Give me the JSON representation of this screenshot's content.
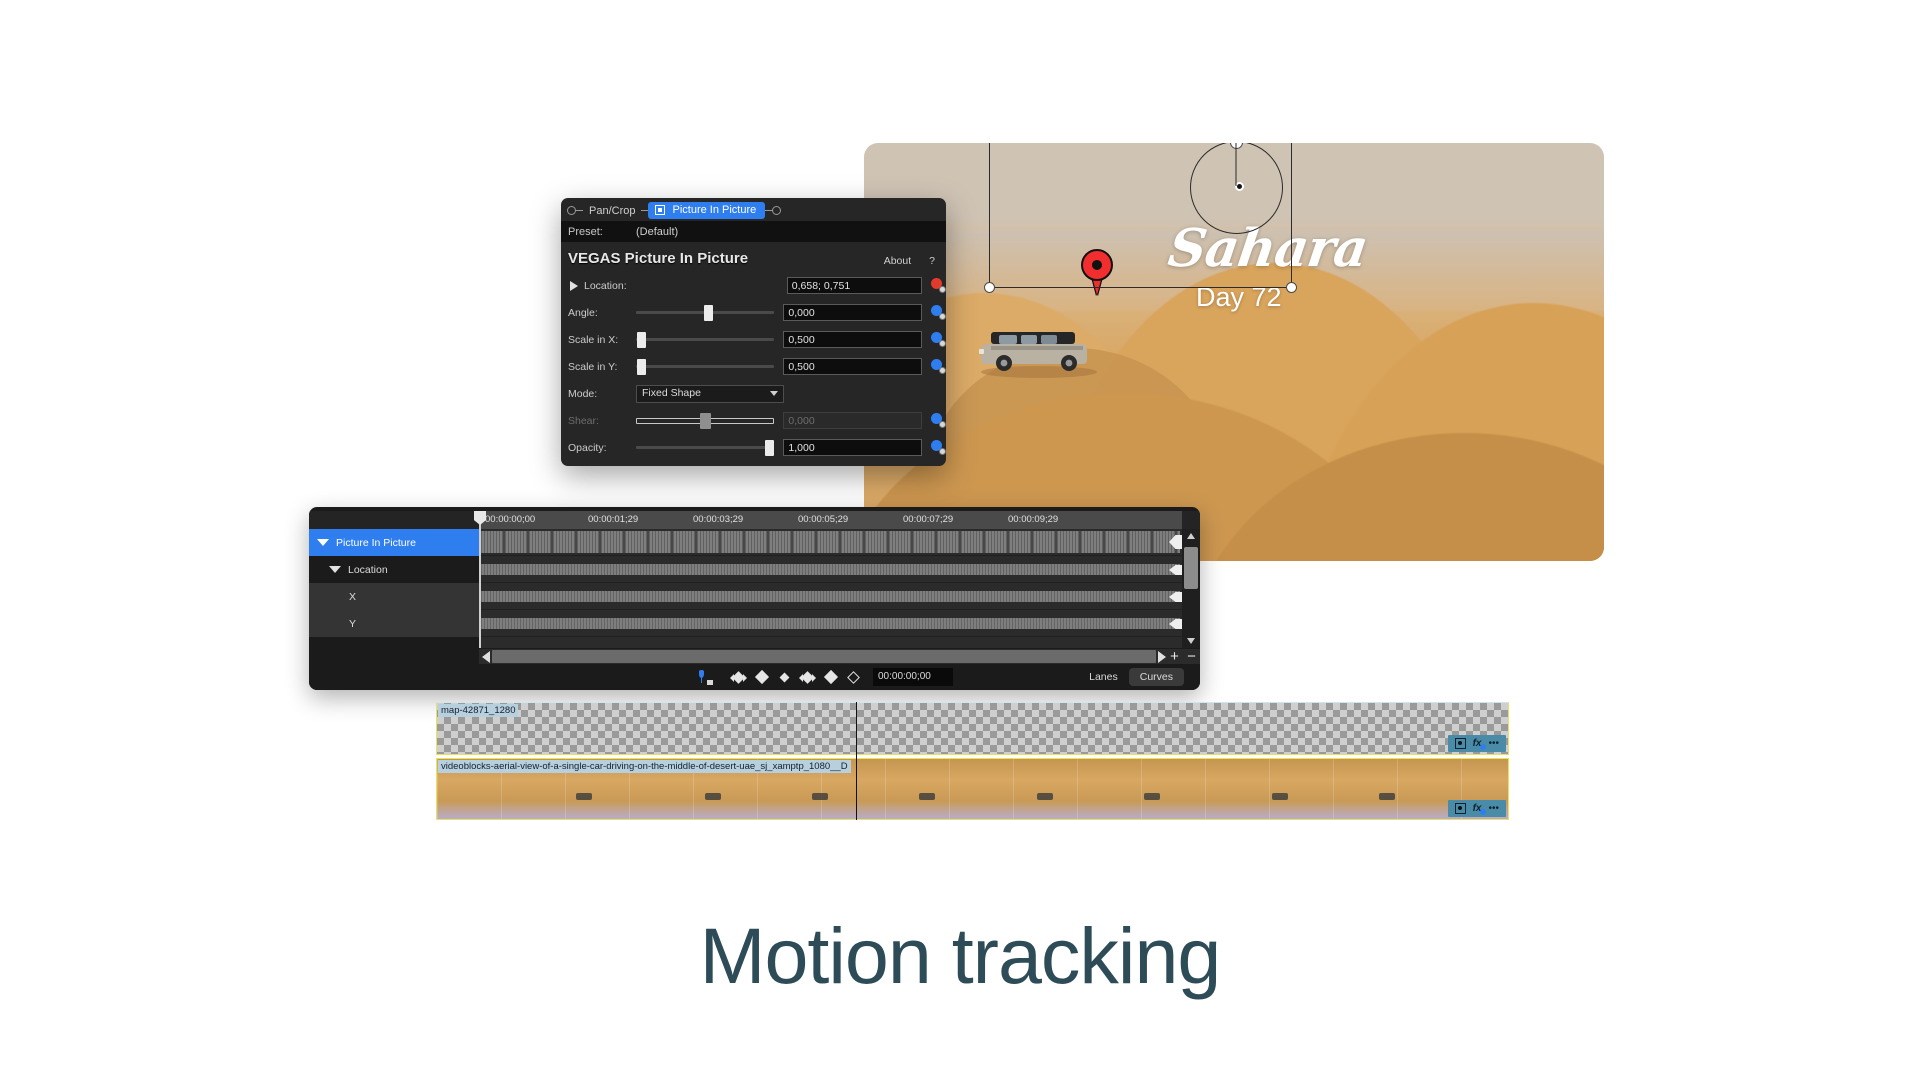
{
  "caption": "Motion tracking",
  "accent_colors": {
    "caption_text": "#2d4c57",
    "selection_blue": "#2f7ef0",
    "keyframe_red": "#e23b2e",
    "pin_red": "#f12d2d",
    "clip_border_yellow": "#e8e35a"
  },
  "preview": {
    "overlay_title": "Sahara",
    "overlay_subtitle": "Day 72",
    "pin_icon": "map-pin-icon"
  },
  "plugin": {
    "tabs": [
      {
        "label": "Pan/Crop",
        "active": false
      },
      {
        "label": "Picture In Picture",
        "active": true
      }
    ],
    "preset_label": "Preset:",
    "preset_value": "(Default)",
    "title": "VEGAS Picture In Picture",
    "about_label": "About",
    "help_label": "?",
    "params": [
      {
        "label": "Location:",
        "value": "0,658; 0,751",
        "type": "expander",
        "keyframe": "red",
        "disabled": false
      },
      {
        "label": "Angle:",
        "value": "0,000",
        "type": "slider",
        "thumb_pct": 50,
        "keyframe": "blue",
        "disabled": false
      },
      {
        "label": "Scale in X:",
        "value": "0,500",
        "type": "slider",
        "thumb_pct": 2,
        "keyframe": "blue",
        "disabled": false
      },
      {
        "label": "Scale in Y:",
        "value": "0,500",
        "type": "slider",
        "thumb_pct": 2,
        "keyframe": "blue",
        "disabled": false
      },
      {
        "label": "Mode:",
        "value": "Fixed Shape",
        "type": "select",
        "disabled": false
      },
      {
        "label": "Shear:",
        "value": "0,000",
        "type": "slider",
        "thumb_pct": 48,
        "keyframe": "blue",
        "disabled": true
      },
      {
        "label": "Opacity:",
        "value": "1,000",
        "type": "slider",
        "thumb_pct": 97,
        "keyframe": "blue",
        "disabled": false
      }
    ]
  },
  "keyframe_panel": {
    "ruler_ticks": [
      {
        "time": "00:00:00;00",
        "x_pct": 0
      },
      {
        "time": "00:00:01;29",
        "x_pct": 15.5
      },
      {
        "time": "00:00:03;29",
        "x_pct": 33.4
      },
      {
        "time": "00:00:05;29",
        "x_pct": 51.3
      },
      {
        "time": "00:00:07;29",
        "x_pct": 69.2
      },
      {
        "time": "00:00:09;29",
        "x_pct": 87.1
      }
    ],
    "tree_rows": [
      {
        "label": "Picture In Picture",
        "level": 0,
        "selected": true,
        "expanded": true
      },
      {
        "label": "Location",
        "level": 1,
        "selected": false,
        "expanded": true
      },
      {
        "label": "X",
        "level": 2,
        "selected": false,
        "expanded": false
      },
      {
        "label": "Y",
        "level": 2,
        "selected": false,
        "expanded": false
      }
    ],
    "timecode": "00:00:00;00",
    "buttons": {
      "lanes": "Lanes",
      "curves": "Curves"
    },
    "icons": [
      "keyframe-lock-icon",
      "keyframe-prev-next-icon",
      "keyframe-add-icon",
      "keyframe-small-icon",
      "keyframe-previous-icon",
      "keyframe-set-icon",
      "keyframe-delete-icon"
    ],
    "transport": {
      "play": "play-icon",
      "zoom_in": "+",
      "zoom_out": "−"
    }
  },
  "timeline_tracks": [
    {
      "name": "map-42871_1280",
      "type": "overlay",
      "buttons": [
        "crop-icon",
        "fx-icon",
        "more-options-icon"
      ]
    },
    {
      "name": "videoblocks-aerial-view-of-a-single-car-driving-on-the-middle-of-desert-uae_sj_xamptp_1080__D",
      "type": "video",
      "buttons": [
        "crop-icon",
        "fx-icon",
        "more-options-icon"
      ]
    }
  ]
}
